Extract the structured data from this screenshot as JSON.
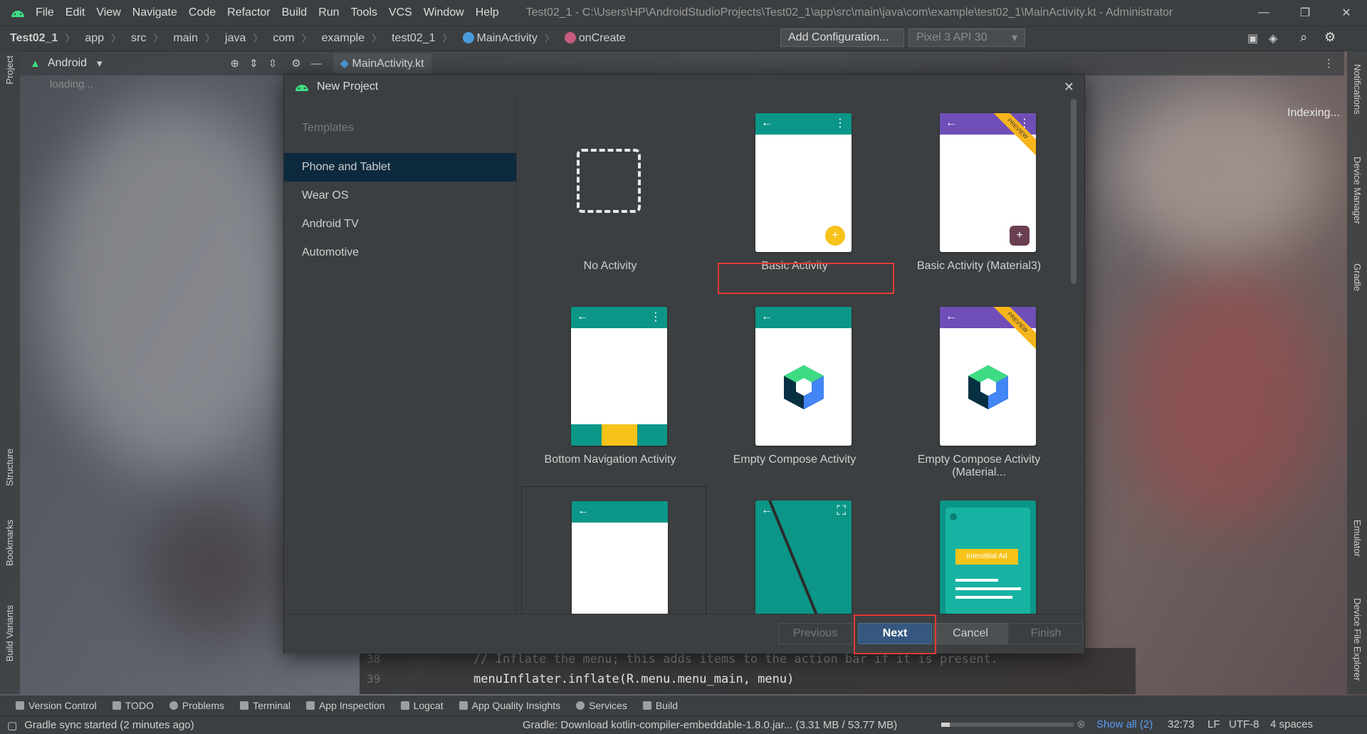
{
  "menubar": {
    "items": [
      "File",
      "Edit",
      "View",
      "Navigate",
      "Code",
      "Refactor",
      "Build",
      "Run",
      "Tools",
      "VCS",
      "Window",
      "Help"
    ],
    "window_title": "Test02_1 - C:\\Users\\HP\\AndroidStudioProjects\\Test02_1\\app\\src\\main\\java\\com\\example\\test02_1\\MainActivity.kt - Administrator"
  },
  "breadcrumb": {
    "items": [
      "Test02_1",
      "app",
      "src",
      "main",
      "java",
      "com",
      "example",
      "test02_1",
      "MainActivity",
      "onCreate"
    ]
  },
  "toolbar": {
    "run_config": "Add Configuration...",
    "device": "Pixel 3 API 30"
  },
  "project_panel": {
    "view_mode": "Android",
    "loading": "loading...",
    "editor_tab": "MainActivity.kt",
    "indexing": "Indexing..."
  },
  "left_stripe": [
    "Project",
    "Structure",
    "Bookmarks",
    "Build Variants"
  ],
  "right_stripe": [
    "Notifications",
    "Device Manager",
    "Gradle",
    "Emulator",
    "Device File Explorer"
  ],
  "dialog": {
    "title": "New Project",
    "sidebar_header": "Templates",
    "categories": [
      {
        "label": "Phone and Tablet",
        "selected": true
      },
      {
        "label": "Wear OS",
        "selected": false
      },
      {
        "label": "Android TV",
        "selected": false
      },
      {
        "label": "Automotive",
        "selected": false
      }
    ],
    "templates": [
      {
        "label": "No Activity"
      },
      {
        "label": "Basic Activity",
        "selected": true
      },
      {
        "label": "Basic Activity (Material3)",
        "badge": "PREVIEW"
      },
      {
        "label": "Bottom Navigation Activity"
      },
      {
        "label": "Empty Compose Activity"
      },
      {
        "label": "Empty Compose Activity (Material...",
        "badge": "PREVIEW"
      },
      {
        "label": ""
      },
      {
        "label": ""
      },
      {
        "label": "",
        "ad_text": "Interstitial Ad"
      }
    ],
    "buttons": {
      "previous": "Previous",
      "next": "Next",
      "cancel": "Cancel",
      "finish": "Finish"
    }
  },
  "code": {
    "lines": [
      {
        "num": "38",
        "text": "// Inflate the menu; this adds items to the action bar if it is present."
      },
      {
        "num": "39",
        "text": "menuInflater.inflate(R.menu.menu_main, menu)"
      }
    ]
  },
  "bottom_tools": [
    "Version Control",
    "TODO",
    "Problems",
    "Terminal",
    "App Inspection",
    "Logcat",
    "App Quality Insights",
    "Services",
    "Build"
  ],
  "status": {
    "left": "Gradle sync started (2 minutes ago)",
    "progress_text": "Gradle: Download kotlin-compiler-embeddable-1.8.0.jar... (3.31 MB / 53.77 MB)",
    "progress_fraction": 0.062,
    "show_all": "Show all (2)",
    "position": "32:73",
    "line_sep": "LF",
    "encoding": "UTF-8",
    "indent": "4 spaces"
  },
  "colors": {
    "selection": "#0d293e",
    "highlight_box": "#e53935",
    "teal": "#0b9688",
    "purple": "#6f4fb7",
    "primary_button": "#365880"
  }
}
